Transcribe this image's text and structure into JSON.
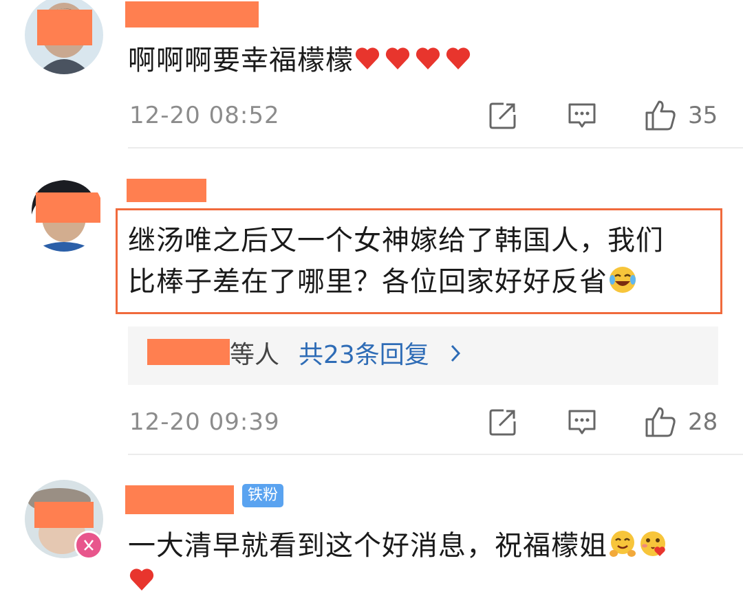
{
  "comments": [
    {
      "text": "啊啊啊要幸福檬檬",
      "timestamp": "12-20 08:52",
      "likes": "35",
      "trailing_emoji": [
        "red-heart",
        "red-heart",
        "red-heart",
        "red-heart"
      ]
    },
    {
      "text_line1": "继汤唯之后又一个女神嫁给了韩国人，我们",
      "text_line2": "比棒子差在了哪里？各位回家好好反省",
      "trailing_emoji": [
        "laughing-crying"
      ],
      "replies": {
        "and_people": "等人",
        "link": "共23条回复"
      },
      "timestamp": "12-20 09:39",
      "likes": "28"
    },
    {
      "badge": "铁粉",
      "text": "一大清早就看到这个好消息，祝福檬姐",
      "trailing_emoji": [
        "hug",
        "blushing-heart",
        "red-heart"
      ]
    }
  ],
  "colors": {
    "censor": "#ff7f50",
    "highlight_border": "#f06a3c",
    "link": "#2e6cb6",
    "badge": "#5aa3f0",
    "timestamp": "#8c8c8c"
  },
  "icons": [
    "forward-icon",
    "comment-icon",
    "thumbs-up-icon",
    "chevron-right-icon"
  ]
}
